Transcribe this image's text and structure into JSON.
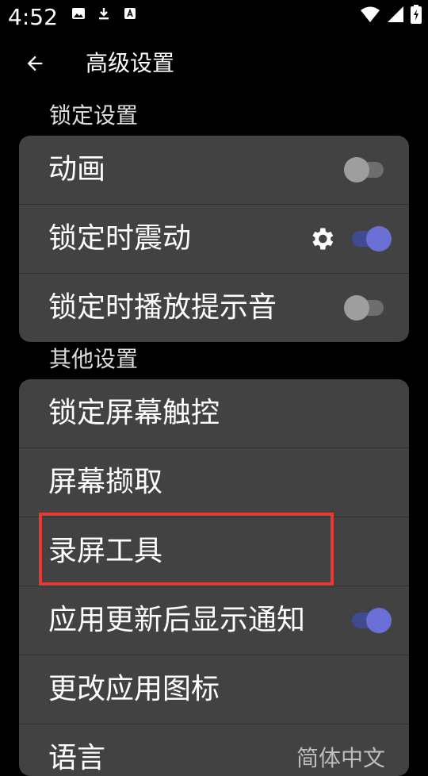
{
  "status": {
    "time": "4:52",
    "icons": [
      "image-icon",
      "download-icon",
      "font-icon",
      "wifi-icon",
      "signal-icon",
      "battery-charging-icon"
    ]
  },
  "appbar": {
    "title": "高级设置",
    "back_icon": "arrow-back-icon"
  },
  "sections": [
    {
      "title": "锁定设置",
      "items": [
        {
          "label": "动画",
          "control": "switch",
          "checked": false
        },
        {
          "label": "锁定时震动",
          "control": "switch",
          "checked": true,
          "extra_icon": "gear-icon"
        },
        {
          "label": "锁定时播放提示音",
          "control": "switch",
          "checked": false
        }
      ]
    },
    {
      "title": "其他设置",
      "items": [
        {
          "label": "锁定屏幕触控"
        },
        {
          "label": "屏幕撷取"
        },
        {
          "label": "录屏工具",
          "highlighted": true
        },
        {
          "label": "应用更新后显示通知",
          "control": "switch",
          "checked": true
        },
        {
          "label": "更改应用图标"
        },
        {
          "label": "语言",
          "value": "简体中文"
        }
      ]
    }
  ],
  "colors": {
    "card_bg": "#424242",
    "switch_on_thumb": "#6b6fd6",
    "switch_on_track": "#3f4a8f",
    "switch_off_thumb": "#9e9e9e",
    "highlight": "#e53935"
  }
}
